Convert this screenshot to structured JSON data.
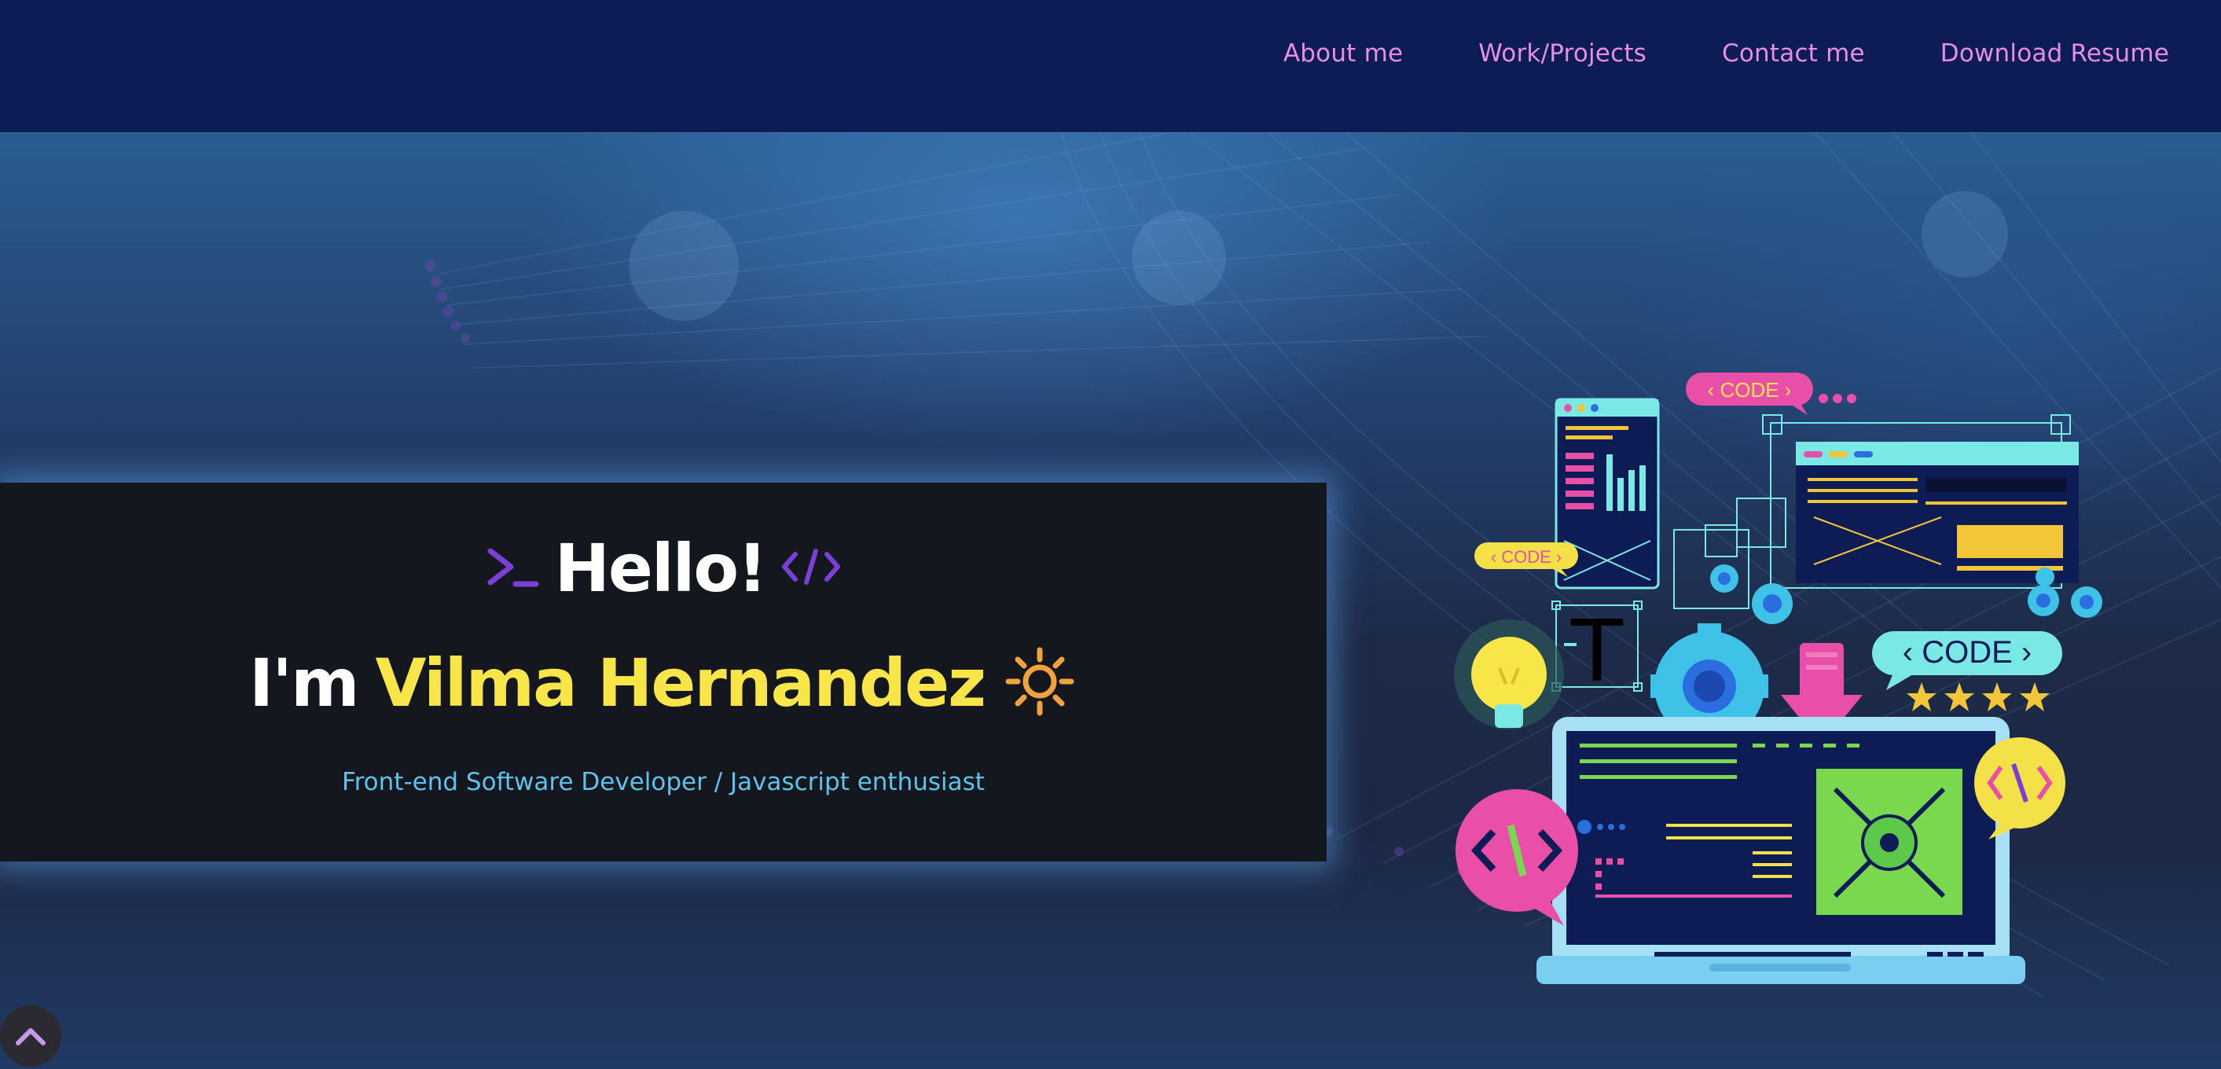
{
  "nav": {
    "items": [
      {
        "label": "About me"
      },
      {
        "label": "Work/Projects"
      },
      {
        "label": "Contact me"
      },
      {
        "label": "Download Resume"
      }
    ]
  },
  "intro": {
    "greeting": "Hello!",
    "prefix": "I'm",
    "name": "Vilma Hernandez",
    "tagline": "Front-end Software Developer / Javascript enthusiast",
    "icons": [
      "terminal-prompt-icon",
      "code-tag-icon",
      "sun-icon"
    ]
  },
  "illustration": {
    "bubble_labels": [
      "CODE",
      "CODE",
      "CODE"
    ],
    "big_letter": "T"
  },
  "scroll_top": {
    "icon": "chevron-up-icon"
  },
  "colors": {
    "nav_bg": "#0d1c54",
    "nav_link": "#e58ee4",
    "banner_bg": "#15171e",
    "accent_yellow": "#f8e547",
    "accent_purple": "#7a3fd6",
    "tagline": "#5cc3ec",
    "sun": "#f0a33a"
  }
}
